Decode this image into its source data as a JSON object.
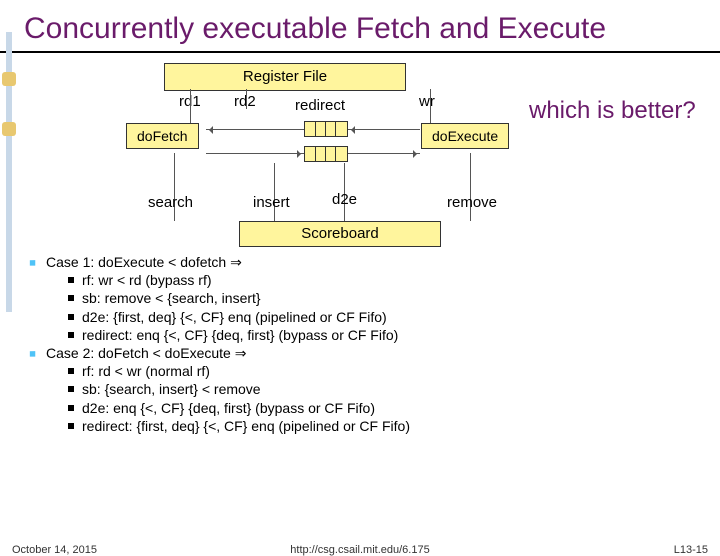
{
  "title": "Concurrently executable Fetch and Execute",
  "diagram": {
    "regfile": "Register File",
    "scoreboard": "Scoreboard",
    "rd1": "rd1",
    "rd2": "rd2",
    "redirect": "redirect",
    "wr": "wr",
    "dofetch": "doFetch",
    "doexec": "doExecute",
    "search": "search",
    "insert": "insert",
    "d2e": "d2e",
    "remove": "remove",
    "which": "which is better?"
  },
  "cases": {
    "c1": "Case 1: doExecute < dofetch   ⇒",
    "c1rf": "rf:           wr < rd                                    (bypass rf)",
    "c1sb": "sb:           remove < {search, insert}",
    "c1d2e": "d2e:         {first, deq} {<, CF} enq (pipelined or CF Fifo)",
    "c1redirect": "redirect: enq {<, CF} {deq, first} (bypass or CF Fifo)",
    "c2": "Case 2: doFetch < doExecute   ⇒",
    "c2rf": "rf:           rd < wr                                    (normal rf)",
    "c2sb": "sb:          {search, insert} < remove",
    "c2d2e": "d2e:        enq {<, CF} {deq, first} (bypass or CF Fifo)",
    "c2redirect": "redirect: {first, deq} {<, CF} enq (pipelined or CF Fifo)"
  },
  "footer": {
    "left": "October 14, 2015",
    "center": "http://csg.csail.mit.edu/6.175",
    "right": "L13-15"
  }
}
